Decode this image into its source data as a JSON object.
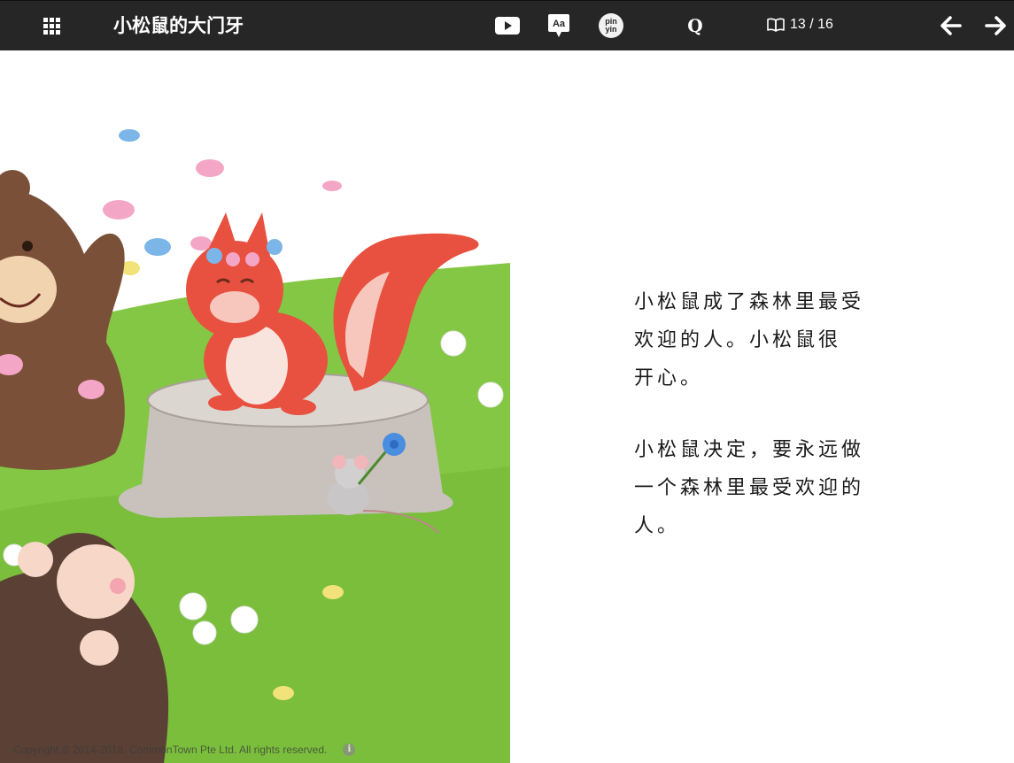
{
  "toolbar": {
    "book_title": "小松鼠的大门牙",
    "font_icon_label": "Aa",
    "pinyin_label_top": "pin",
    "pinyin_label_bottom": "yin",
    "search_label": "Q",
    "page_indicator": "13 / 16",
    "icons": {
      "menu": "grid-icon",
      "video": "play-icon",
      "font": "font-size-icon",
      "pinyin": "pinyin-icon",
      "search": "search-icon",
      "page": "book-icon",
      "prev": "arrow-left-icon",
      "next": "arrow-right-icon"
    }
  },
  "story": {
    "paragraphs": [
      "小松鼠成了森林里最受\n欢迎的人。小松鼠很\n开心。",
      "小松鼠决定，要永远做\n一个森林里最受欢迎的\n人。"
    ]
  },
  "footer": {
    "copyright": "Copyright © 2014-2018. CommonTown Pte Ltd. All rights reserved.",
    "info_label": "i"
  },
  "colors": {
    "toolbar_bg": "#262626",
    "toolbar_fg": "#ffffff",
    "page_bg": "#ffffff",
    "text": "#1a1a1a",
    "grass": "#7cc23f",
    "squirrel": "#e8503f",
    "bear": "#7a5138"
  },
  "illustration": {
    "characters": [
      "bear",
      "squirrel",
      "mouse",
      "monkey"
    ]
  }
}
